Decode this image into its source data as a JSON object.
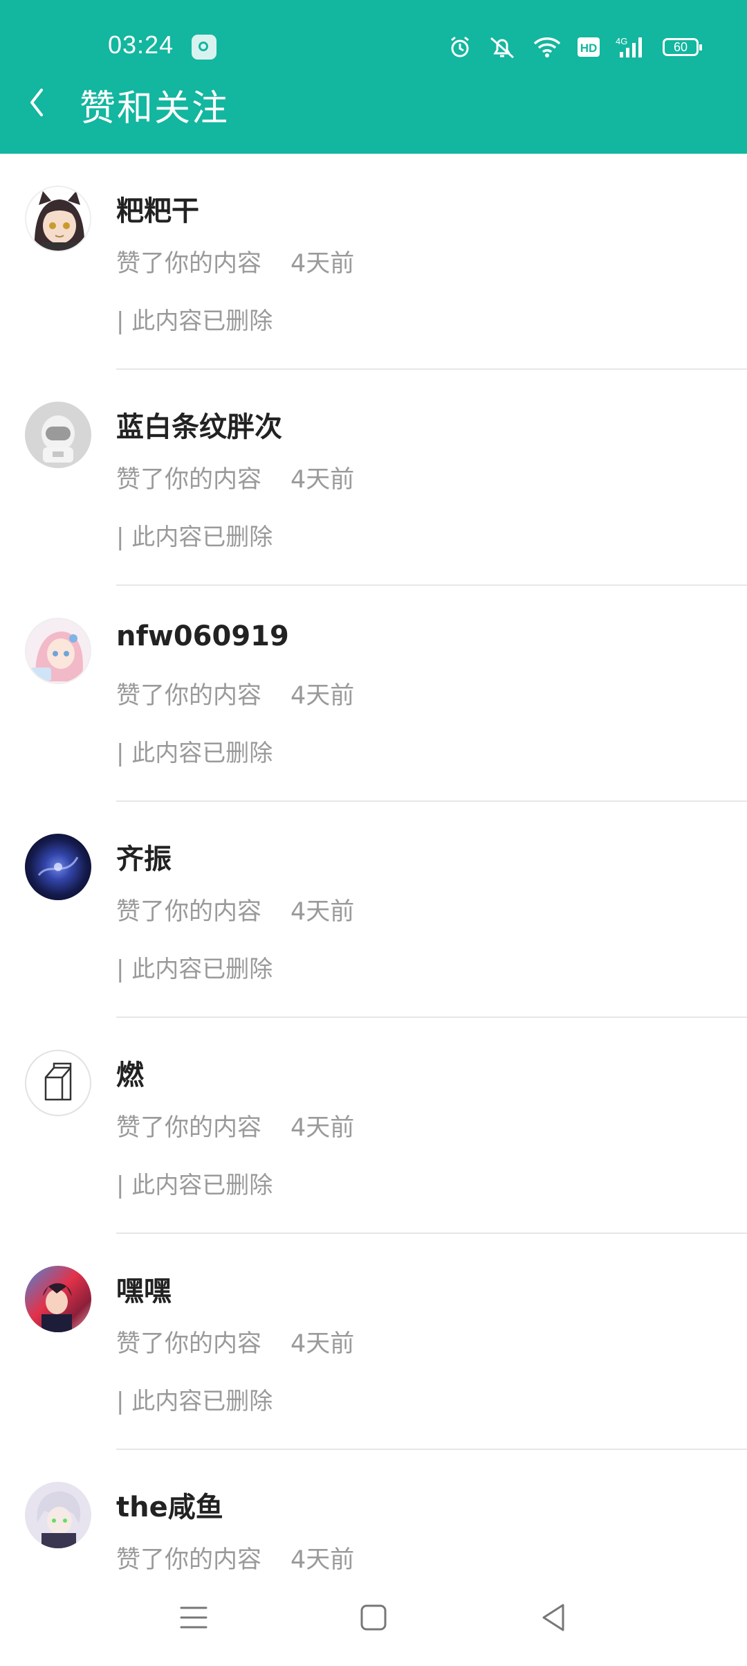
{
  "status_bar": {
    "time": "03:24",
    "battery": "60",
    "hd_label": "HD",
    "network_label": "4G"
  },
  "header": {
    "title": "赞和关注"
  },
  "notifications": [
    {
      "name": "粑粑干",
      "action": "赞了你的内容",
      "time": "4天前",
      "content": "| 此内容已删除",
      "avatar": "avatar-anime-girl"
    },
    {
      "name": "蓝白条纹胖次",
      "action": "赞了你的内容",
      "time": "4天前",
      "content": "| 此内容已删除",
      "avatar": "avatar-astronaut"
    },
    {
      "name": "nfw060919",
      "action": "赞了你的内容",
      "time": "4天前",
      "content": "| 此内容已删除",
      "avatar": "avatar-anime-pink"
    },
    {
      "name": "齐振",
      "action": "赞了你的内容",
      "time": "4天前",
      "content": "| 此内容已删除",
      "avatar": "avatar-galaxy"
    },
    {
      "name": "燃",
      "action": "赞了你的内容",
      "time": "4天前",
      "content": "| 此内容已删除",
      "avatar": "avatar-milk-box"
    },
    {
      "name": "嘿嘿",
      "action": "赞了你的内容",
      "time": "4天前",
      "content": "| 此内容已删除",
      "avatar": "avatar-anime-red"
    },
    {
      "name": "the咸鱼",
      "action": "赞了你的内容",
      "time": "4天前",
      "content": "",
      "avatar": "avatar-anime-boy"
    }
  ],
  "colors": {
    "header": "#13b69f",
    "secondary_text": "#9a9a9a"
  }
}
